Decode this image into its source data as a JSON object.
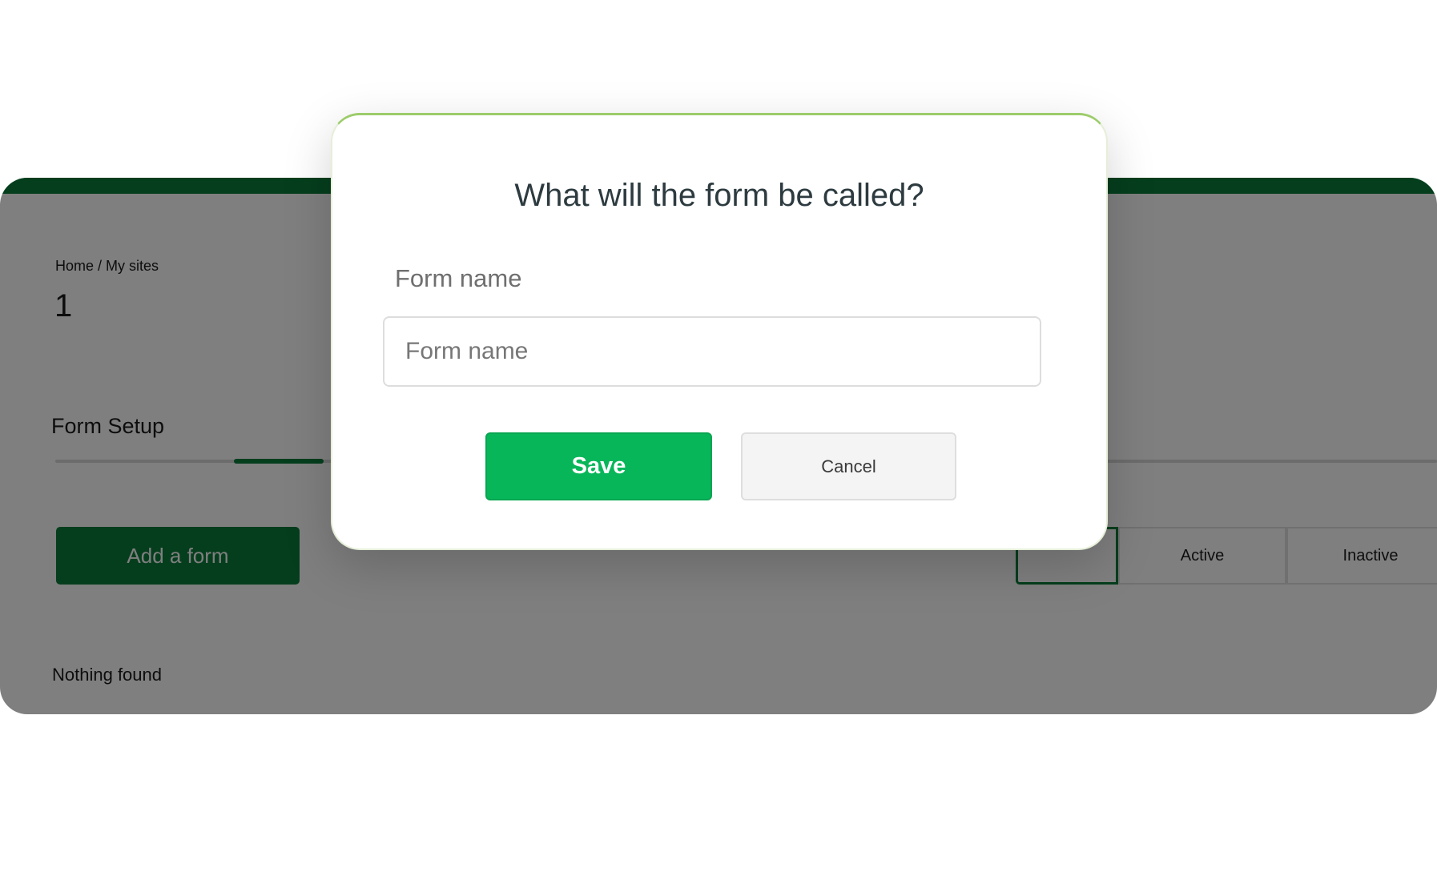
{
  "background": {
    "breadcrumb": "Home / My sites",
    "site_number": "1",
    "tab_label": "Form Setup",
    "add_form_label": "Add a form",
    "filters": {
      "active": "Active",
      "inactive": "Inactive"
    },
    "empty_state": "Nothing found"
  },
  "modal": {
    "title": "What will the form be called?",
    "field_label": "Form name",
    "input_placeholder": "Form name",
    "input_value": "",
    "save_label": "Save",
    "cancel_label": "Cancel"
  },
  "colors": {
    "brand_green": "#0a7d3b",
    "save_green": "#08b65a",
    "overlay": "rgba(0,0,0,0.5)"
  }
}
